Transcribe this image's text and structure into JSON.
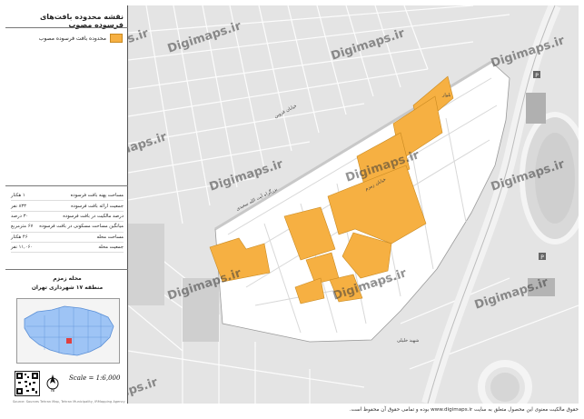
{
  "panel": {
    "title": "نقشه محدوده بافت‌های فرسوده مصوب",
    "legend_label": "محدوده بافت فرسوده مصوب",
    "stats": [
      {
        "label": "مساحت پهنه بافت فرسوده",
        "value": "۱ هکتار"
      },
      {
        "label": "جمعیت ارائه بافت فرسوده",
        "value": "۸۳۳ نفر"
      },
      {
        "label": "درصد مالکیت در بافت فرسوده",
        "value": "۳۰ درصد"
      },
      {
        "label": "میانگین مساحت مسکونی در بافت فرسوده",
        "value": "۶۷ مترمربع"
      },
      {
        "label": "مساحت محله",
        "value": "۴۶ هکتار"
      },
      {
        "label": "جمعیت محله",
        "value": "۱۱,۰۶۰ نفر"
      }
    ],
    "district_line1": "محله زمزم",
    "district_line2": "منطقه ۱۷ شهرداری تهران",
    "scale": "Scale = 1:6,000",
    "credit": "Source: Sources Tehran Map, Tehran Municipality, IRMapping Agency"
  },
  "map_labels": [
    {
      "text": "بزرگراه آیت الله سعیدی"
    },
    {
      "text": "خیابان زمزم"
    },
    {
      "text": "بلوار"
    },
    {
      "text": "خیابان قزوین"
    },
    {
      "text": "شهید خلیلی"
    }
  ],
  "watermarks": [
    "Digimaps.ir",
    "Digimaps.ir",
    "Digimaps.ir",
    "Digimaps.ir",
    "Digimaps.ir",
    "Digimaps.ir",
    "Digimaps.ir",
    "Digimaps.ir",
    "Digimaps.ir",
    "Digimaps.ir",
    "Digimaps.ir",
    "Digimaps.ir"
  ],
  "footer": "حقوق مالکیت معنوی این محصول متعلق به سایت www.digimaps.ir بوده و تمامی حقوق آن محفوظ است.",
  "colors": {
    "fabric": "#f6b042",
    "study_area": "#ffffff",
    "background": "#e4e4e4",
    "minimap_district": "#9ec4f5",
    "minimap_highlight": "#e04040"
  }
}
